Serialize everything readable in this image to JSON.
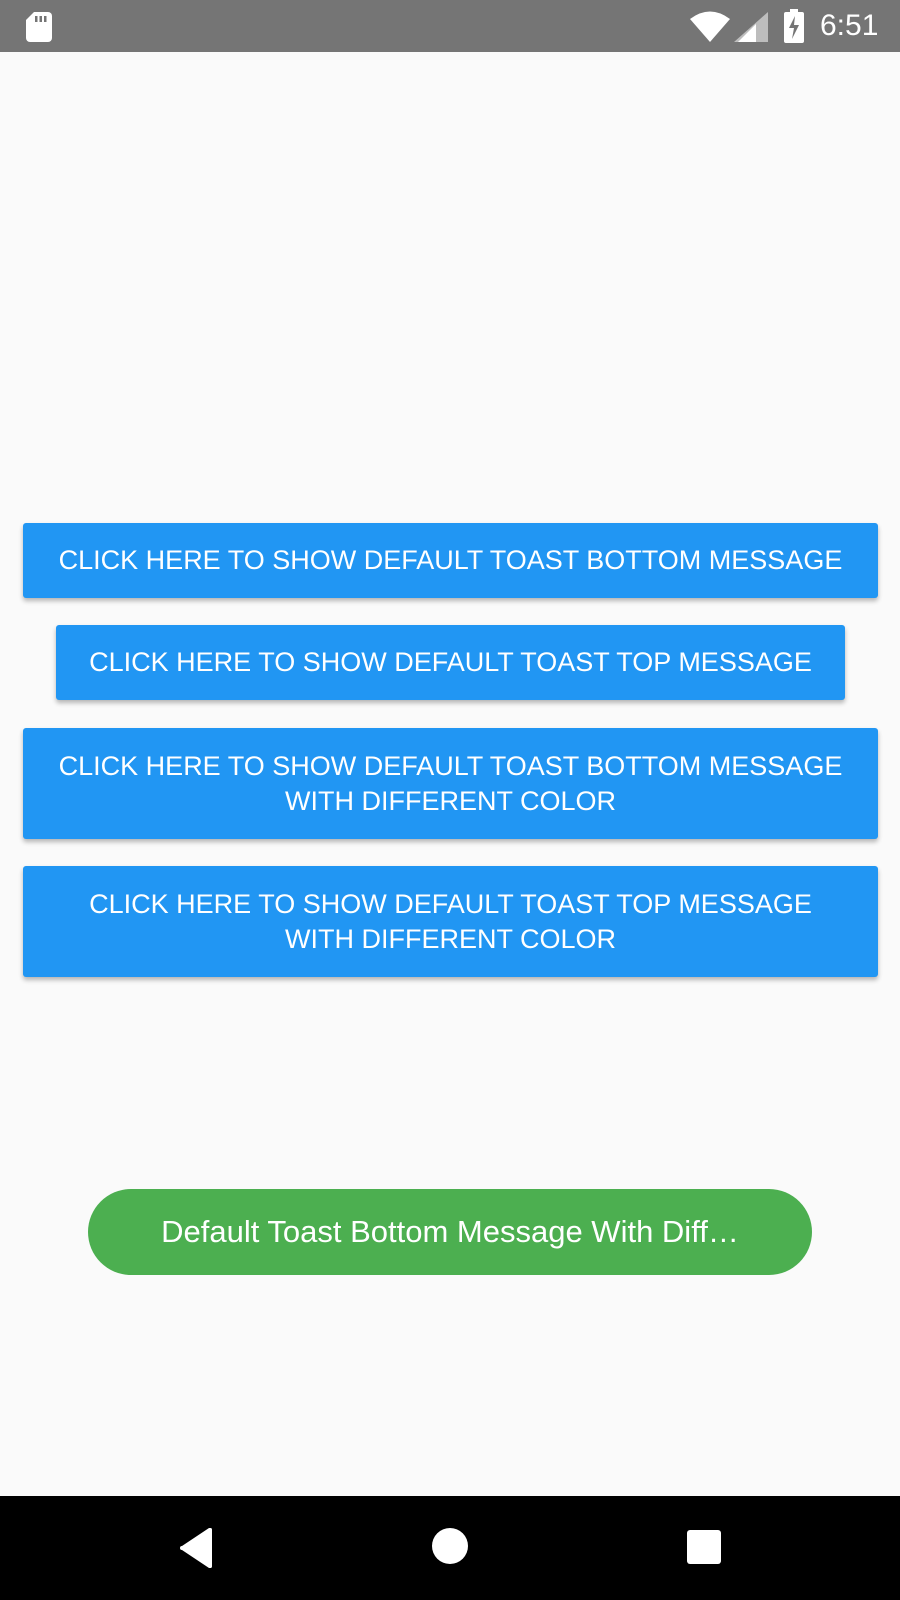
{
  "status_bar": {
    "time": "6:51",
    "icons": [
      "sd-card-icon",
      "wifi-icon",
      "cell-signal-icon",
      "battery-charging-icon"
    ]
  },
  "buttons": [
    {
      "label": "CLICK HERE TO SHOW DEFAULT TOAST BOTTOM MESSAGE"
    },
    {
      "label": "CLICK HERE TO SHOW DEFAULT TOAST TOP MESSAGE"
    },
    {
      "label": "CLICK HERE TO SHOW DEFAULT TOAST BOTTOM MESSAGE\nWITH DIFFERENT COLOR"
    },
    {
      "label": "CLICK HERE TO SHOW DEFAULT TOAST TOP MESSAGE\nWITH DIFFERENT COLOR"
    }
  ],
  "toast": {
    "message": "Default Toast Bottom Message With Diff…"
  },
  "nav_bar": {
    "icons": [
      "back-icon",
      "home-icon",
      "recent-apps-icon"
    ]
  },
  "colors": {
    "status_bar": "#757575",
    "background": "#fafafa",
    "button": "#2196f3",
    "button_text": "#ffffff",
    "toast": "#4caf50",
    "nav_bar": "#000000"
  }
}
